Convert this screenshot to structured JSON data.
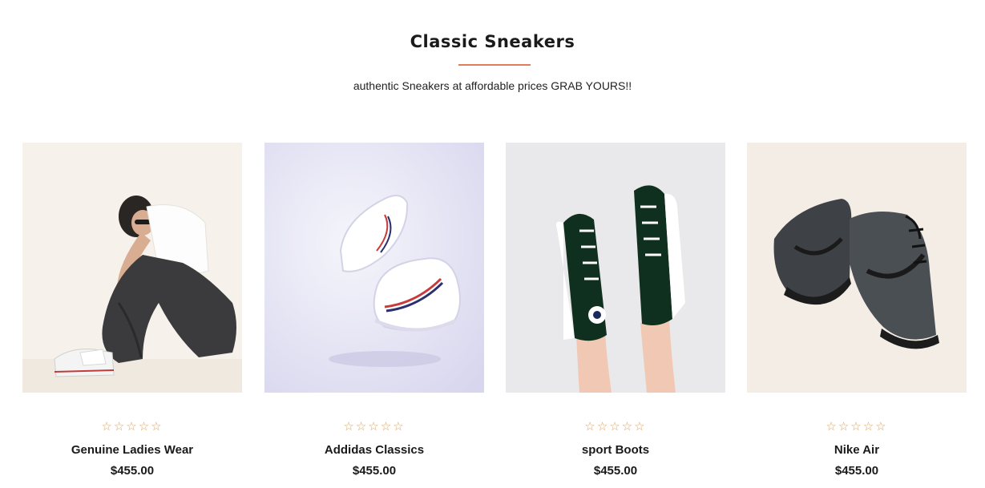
{
  "section": {
    "title": "Classic Sneakers",
    "subtitle": "authentic Sneakers at affordable prices GRAB YOURS!!",
    "accent_color": "#e27c5a"
  },
  "rating_icon": "star-outline-icon",
  "rating_color": "#d9a46a",
  "rating_star_glyph": "☆",
  "products": [
    {
      "name": "Genuine Ladies Wear",
      "price": "$455.00",
      "image_icon": "woman-in-sneakers-image",
      "rating_stars_filled": 0
    },
    {
      "name": "Addidas Classics",
      "price": "$455.00",
      "image_icon": "white-sneakers-image",
      "rating_stars_filled": 0
    },
    {
      "name": "sport Boots",
      "price": "$455.00",
      "image_icon": "green-high-tops-image",
      "rating_stars_filled": 0
    },
    {
      "name": "Nike Air",
      "price": "$455.00",
      "image_icon": "black-high-tops-image",
      "rating_stars_filled": 0
    }
  ]
}
